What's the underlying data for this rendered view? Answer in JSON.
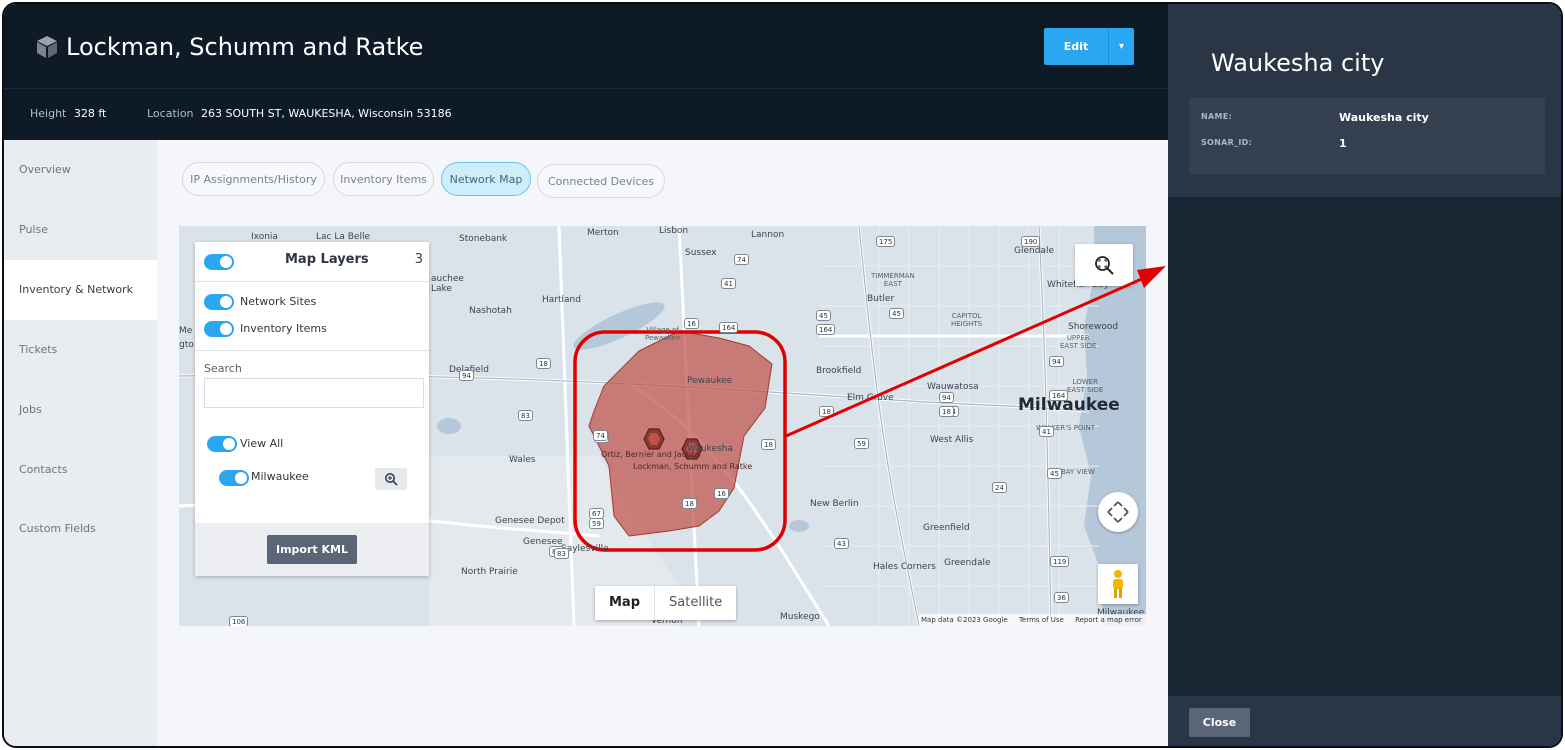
{
  "header": {
    "title": "Lockman, Schumm and Ratke",
    "edit_label": "Edit"
  },
  "subheader": {
    "height_label": "Height",
    "height_value": "328 ft",
    "location_label": "Location",
    "location_value": "263 SOUTH ST, WAUKESHA, Wisconsin 53186"
  },
  "sidebar": {
    "items": [
      {
        "label": "Overview"
      },
      {
        "label": "Pulse"
      },
      {
        "label": "Inventory & Network"
      },
      {
        "label": "Tickets"
      },
      {
        "label": "Jobs"
      },
      {
        "label": "Contacts"
      },
      {
        "label": "Custom Fields"
      }
    ],
    "active_index": 2
  },
  "tabs": [
    {
      "label": "IP Assignments/History"
    },
    {
      "label": "Inventory Items"
    },
    {
      "label": "Network Map"
    },
    {
      "label": "Connected Devices"
    }
  ],
  "layers_panel": {
    "title": "Map Layers",
    "count": "3",
    "network_sites": "Network Sites",
    "inventory_items": "Inventory Items",
    "search_label": "Search",
    "search_value": "",
    "view_all": "View All",
    "milwaukee": "Milwaukee",
    "import_label": "Import KML"
  },
  "map": {
    "map_type_map": "Map",
    "map_type_satellite": "Satellite",
    "attribution": {
      "data": "Map data ©2023 Google",
      "terms": "Terms of Use",
      "report": "Report a map error"
    },
    "places": {
      "ixonia": "Ixonia",
      "lac_la_belle": "Lac La Belle",
      "stonebank": "Stonebank",
      "merton": "Merton",
      "lisbon": "Lisbon",
      "lannon": "Lannon",
      "sussex": "Sussex",
      "glendale": "Glendale",
      "auchee": "auchee",
      "lake": "Lake",
      "hartland": "Hartland",
      "nashotah": "Nashotah",
      "timmerman": "TIMMERMAN\nEAST",
      "butler": "Butler",
      "whitefish_bay": "Whitefish Bay",
      "village_of_pewaukee": "Village of\nPewaukee",
      "capitol_heights": "CAPITOL\nHEIGHTS",
      "shorewood": "Shorewood",
      "upper_east_side": "UPPER\nEAST SIDE",
      "delafield": "Delafield",
      "pewaukee": "Pewaukee",
      "brookfield": "Brookfield",
      "wauwatosa": "Wauwatosa",
      "lower_east_side": "LOWER\nEAST SIDE",
      "milwaukee": "Milwaukee",
      "elm_grove": "Elm Grove",
      "walkers_point": "WALKER'S POINT",
      "west_allis": "West Allis",
      "wales": "Wales",
      "bay_view": "BAY VIEW",
      "new_berlin": "New Berlin",
      "genesee_depot": "Genesee Depot",
      "genesee": "Genesee",
      "saylesville": "Saylesville",
      "greenfield": "Greenfield",
      "greendale": "Greendale",
      "north_prairie": "North Prairie",
      "hales_corners": "Hales Corners",
      "muskego": "Muskego",
      "vernon": "Vernon",
      "milwaukee_bottom": "Milwaukee",
      "mem": "Me",
      "gto": "gto",
      "waukesha": "Waukesha"
    },
    "marker_labels": {
      "ortiz": "Ortiz, Bernier and Jacobs",
      "lockman": "Lockman, Schumm and Ratke"
    },
    "highway_numbers": [
      "175",
      "190",
      "74",
      "41",
      "45",
      "45",
      "164",
      "16",
      "164",
      "94",
      "94",
      "18",
      "83",
      "59",
      "18",
      "94",
      "59",
      "18",
      "74",
      "18",
      "164",
      "24",
      "45",
      "41",
      "43",
      "59",
      "119",
      "36",
      "67",
      "83",
      "18",
      "16",
      "83",
      "94",
      "106",
      "43"
    ],
    "colors": {
      "polygon": "#c0524a",
      "highlight": "#e00000",
      "arrow": "#e00000"
    }
  },
  "right_panel": {
    "title": "Waukesha city",
    "name_key": "NAME:",
    "name_value": "Waukesha city",
    "sonar_key": "SONAR_ID:",
    "sonar_value": "1",
    "close_label": "Close"
  },
  "colors": {
    "accent": "#2aa7f0",
    "header_bg": "#0f1a27",
    "panel_bg": "#1a2633"
  }
}
